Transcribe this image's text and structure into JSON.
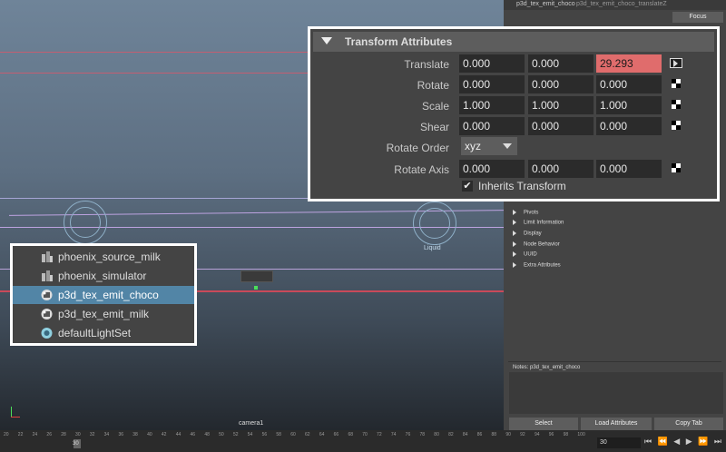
{
  "viewport": {
    "camera_label": "camera1",
    "gizmo_label": "Liquid"
  },
  "attribute_editor": {
    "tabs": [
      "p3d_tex_emit_choco",
      "p3d_tex_emit_choco_translateZ"
    ],
    "focus_label": "Focus",
    "sections": [
      "Pivots",
      "Limit Information",
      "Display",
      "Node Behavior",
      "UUID",
      "Extra Attributes"
    ],
    "notes_label": "Notes: p3d_tex_emit_choco",
    "buttons": {
      "select": "Select",
      "load_attributes": "Load Attributes",
      "copy_tab": "Copy Tab"
    }
  },
  "transform": {
    "title": "Transform Attributes",
    "translate": {
      "label": "Translate",
      "x": "0.000",
      "y": "0.000",
      "z": "29.293"
    },
    "rotate": {
      "label": "Rotate",
      "x": "0.000",
      "y": "0.000",
      "z": "0.000"
    },
    "scale": {
      "label": "Scale",
      "x": "1.000",
      "y": "1.000",
      "z": "1.000"
    },
    "shear": {
      "label": "Shear",
      "x": "0.000",
      "y": "0.000",
      "z": "0.000"
    },
    "rotate_order": {
      "label": "Rotate Order",
      "value": "xyz"
    },
    "rotate_axis": {
      "label": "Rotate Axis",
      "x": "0.000",
      "y": "0.000",
      "z": "0.000"
    },
    "inherits": {
      "label": "Inherits Transform",
      "checked": true,
      "mark": "✔"
    },
    "highlight_color": "#e06c6c"
  },
  "outliner": {
    "items": [
      {
        "label": "phoenix_source_milk",
        "icon": "phoenix-source-icon"
      },
      {
        "label": "phoenix_simulator",
        "icon": "phoenix-simulator-icon"
      },
      {
        "label": "p3d_tex_emit_choco",
        "icon": "texture-emitter-icon",
        "selected": true
      },
      {
        "label": "p3d_tex_emit_milk",
        "icon": "texture-emitter-icon"
      },
      {
        "label": "defaultLightSet",
        "icon": "light-set-icon"
      }
    ]
  },
  "timeline": {
    "ticks": [
      "20",
      "22",
      "24",
      "26",
      "28",
      "30",
      "32",
      "34",
      "36",
      "38",
      "40",
      "42",
      "44",
      "46",
      "48",
      "50",
      "52",
      "54",
      "56",
      "58",
      "60",
      "62",
      "64",
      "66",
      "68",
      "70",
      "72",
      "74",
      "76",
      "78",
      "80",
      "82",
      "84",
      "86",
      "88",
      "90",
      "92",
      "94",
      "96",
      "98",
      "100"
    ],
    "current_frame": "30",
    "frame_field": "30"
  }
}
